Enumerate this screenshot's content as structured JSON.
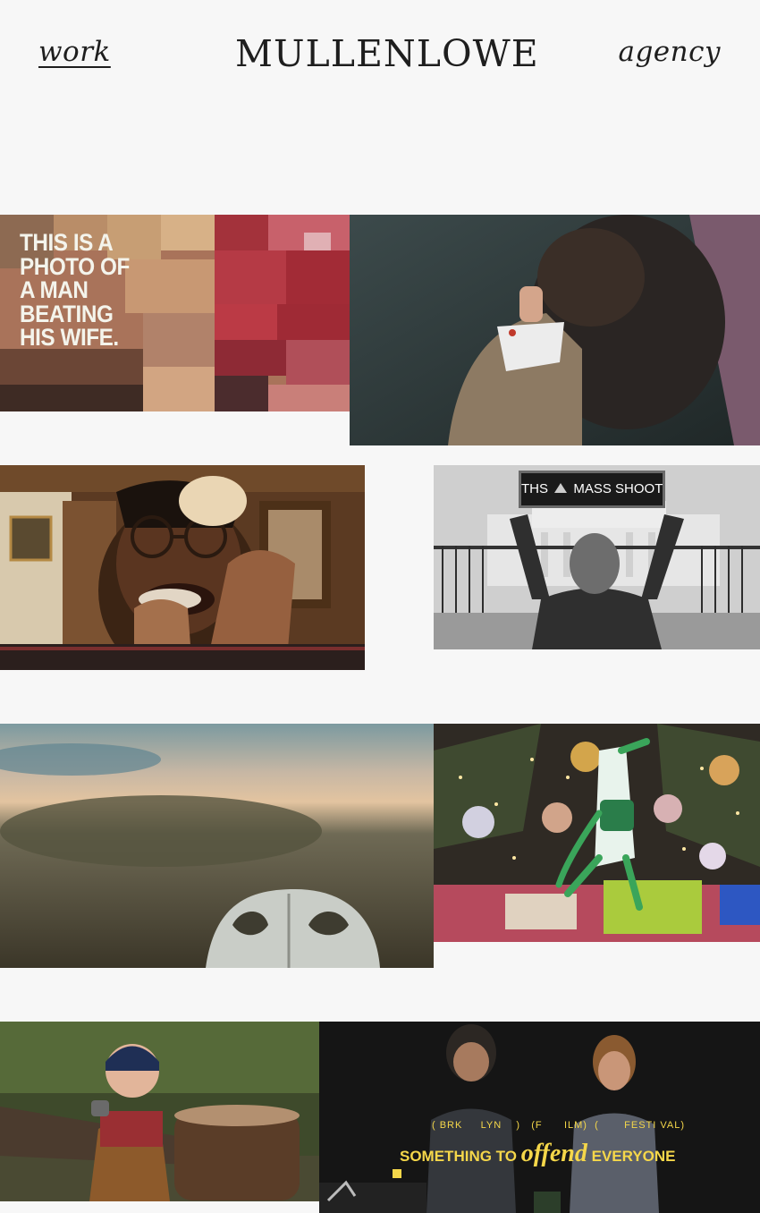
{
  "header": {
    "work_label": "work",
    "logo_text": "MULLENLOWE",
    "agency_label": "agency"
  },
  "tiles": [
    {
      "caption": "THIS IS A PHOTO OF A MAN BEATING HIS WIFE."
    },
    {},
    {},
    {
      "sign_left": "THS",
      "sign_right": "MASS SHOOT"
    },
    {},
    {},
    {},
    {
      "festival": "( BRK     LYN    )   (F      ILM)  (       FESTI VAL)",
      "tag_before": "SOMETHING TO",
      "tag_emph": "offend",
      "tag_after": "EVERYONE"
    }
  ]
}
